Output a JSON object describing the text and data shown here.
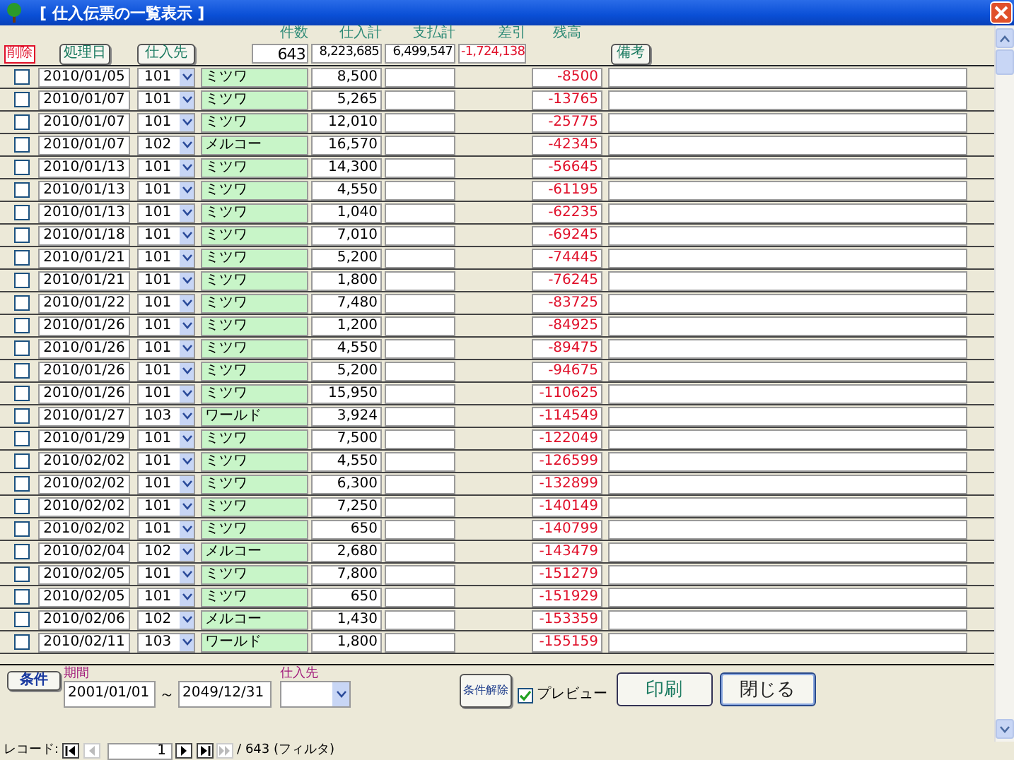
{
  "window": {
    "title": "[ 仕入伝票の一覧表示 ]"
  },
  "header": {
    "labels": [
      "件数",
      "仕入計",
      "支払計",
      "差引",
      "残高"
    ],
    "totals": [
      "643",
      "8,223,685",
      "6,499,547",
      "-1,724,138"
    ],
    "delete_label": "削除",
    "sort_buttons": [
      "処理日",
      "仕入先"
    ],
    "memo_button": "備考"
  },
  "rows": [
    {
      "checked": false,
      "date": "2010/01/05",
      "code": "101",
      "supplier": "ミツワ",
      "amount": "8,500",
      "balance": "-8500"
    },
    {
      "checked": false,
      "date": "2010/01/07",
      "code": "101",
      "supplier": "ミツワ",
      "amount": "5,265",
      "balance": "-13765"
    },
    {
      "checked": false,
      "date": "2010/01/07",
      "code": "101",
      "supplier": "ミツワ",
      "amount": "12,010",
      "balance": "-25775"
    },
    {
      "checked": false,
      "date": "2010/01/07",
      "code": "102",
      "supplier": "メルコー",
      "amount": "16,570",
      "balance": "-42345"
    },
    {
      "checked": false,
      "date": "2010/01/13",
      "code": "101",
      "supplier": "ミツワ",
      "amount": "14,300",
      "balance": "-56645"
    },
    {
      "checked": false,
      "date": "2010/01/13",
      "code": "101",
      "supplier": "ミツワ",
      "amount": "4,550",
      "balance": "-61195"
    },
    {
      "checked": false,
      "date": "2010/01/13",
      "code": "101",
      "supplier": "ミツワ",
      "amount": "1,040",
      "balance": "-62235"
    },
    {
      "checked": false,
      "date": "2010/01/18",
      "code": "101",
      "supplier": "ミツワ",
      "amount": "7,010",
      "balance": "-69245"
    },
    {
      "checked": false,
      "date": "2010/01/21",
      "code": "101",
      "supplier": "ミツワ",
      "amount": "5,200",
      "balance": "-74445"
    },
    {
      "checked": false,
      "date": "2010/01/21",
      "code": "101",
      "supplier": "ミツワ",
      "amount": "1,800",
      "balance": "-76245"
    },
    {
      "checked": false,
      "date": "2010/01/22",
      "code": "101",
      "supplier": "ミツワ",
      "amount": "7,480",
      "balance": "-83725"
    },
    {
      "checked": false,
      "date": "2010/01/26",
      "code": "101",
      "supplier": "ミツワ",
      "amount": "1,200",
      "balance": "-84925"
    },
    {
      "checked": false,
      "date": "2010/01/26",
      "code": "101",
      "supplier": "ミツワ",
      "amount": "4,550",
      "balance": "-89475"
    },
    {
      "checked": false,
      "date": "2010/01/26",
      "code": "101",
      "supplier": "ミツワ",
      "amount": "5,200",
      "balance": "-94675"
    },
    {
      "checked": false,
      "date": "2010/01/26",
      "code": "101",
      "supplier": "ミツワ",
      "amount": "15,950",
      "balance": "-110625"
    },
    {
      "checked": false,
      "date": "2010/01/27",
      "code": "103",
      "supplier": "ワールド",
      "amount": "3,924",
      "balance": "-114549"
    },
    {
      "checked": false,
      "date": "2010/01/29",
      "code": "101",
      "supplier": "ミツワ",
      "amount": "7,500",
      "balance": "-122049"
    },
    {
      "checked": false,
      "date": "2010/02/02",
      "code": "101",
      "supplier": "ミツワ",
      "amount": "4,550",
      "balance": "-126599"
    },
    {
      "checked": false,
      "date": "2010/02/02",
      "code": "101",
      "supplier": "ミツワ",
      "amount": "6,300",
      "balance": "-132899"
    },
    {
      "checked": false,
      "date": "2010/02/02",
      "code": "101",
      "supplier": "ミツワ",
      "amount": "7,250",
      "balance": "-140149"
    },
    {
      "checked": false,
      "date": "2010/02/02",
      "code": "101",
      "supplier": "ミツワ",
      "amount": "650",
      "balance": "-140799"
    },
    {
      "checked": false,
      "date": "2010/02/04",
      "code": "102",
      "supplier": "メルコー",
      "amount": "2,680",
      "balance": "-143479"
    },
    {
      "checked": false,
      "date": "2010/02/05",
      "code": "101",
      "supplier": "ミツワ",
      "amount": "7,800",
      "balance": "-151279"
    },
    {
      "checked": false,
      "date": "2010/02/05",
      "code": "101",
      "supplier": "ミツワ",
      "amount": "650",
      "balance": "-151929"
    },
    {
      "checked": false,
      "date": "2010/02/06",
      "code": "102",
      "supplier": "メルコー",
      "amount": "1,430",
      "balance": "-153359"
    },
    {
      "checked": false,
      "date": "2010/02/11",
      "code": "103",
      "supplier": "ワールド",
      "amount": "1,800",
      "balance": "-155159"
    }
  ],
  "filter": {
    "condition_button": "条件",
    "period_label": "期間",
    "date_from": "2001/01/01",
    "separator": "～",
    "date_to": "2049/12/31",
    "supplier_label": "仕入先",
    "clear_button": "条件解除",
    "preview": {
      "label": "プレビュー",
      "checked": true
    },
    "print_button": "印刷",
    "close_button": "閉じる"
  },
  "navigation": {
    "label": "レコード:",
    "current": "1",
    "total": "/ 643 (フィルタ)"
  }
}
